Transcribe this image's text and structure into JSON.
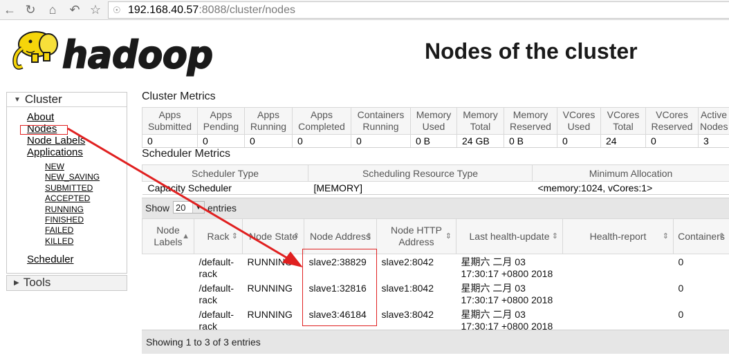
{
  "browser": {
    "url_host": "192.168.40.57",
    "url_rest": ":8088/cluster/nodes",
    "icons": [
      "back-icon",
      "reload-icon",
      "home-icon",
      "undo-icon",
      "star-icon",
      "shield-icon"
    ]
  },
  "header": {
    "logo_text": "hadoop",
    "title": "Nodes of the cluster"
  },
  "sidebar": {
    "cluster_label": "Cluster",
    "links": [
      "About",
      "Nodes",
      "Node Labels",
      "Applications"
    ],
    "app_states": [
      "NEW",
      "NEW_SAVING",
      "SUBMITTED",
      "ACCEPTED",
      "RUNNING",
      "FINISHED",
      "FAILED",
      "KILLED"
    ],
    "scheduler": "Scheduler",
    "tools_label": "Tools"
  },
  "cluster_metrics": {
    "title": "Cluster Metrics",
    "headers": [
      "Apps Submitted",
      "Apps Pending",
      "Apps Running",
      "Apps Completed",
      "Containers Running",
      "Memory Used",
      "Memory Total",
      "Memory Reserved",
      "VCores Used",
      "VCores Total",
      "VCores Reserved",
      "Active Nodes"
    ],
    "values": [
      "0",
      "0",
      "0",
      "0",
      "0",
      "0 B",
      "24 GB",
      "0 B",
      "0",
      "24",
      "0",
      "3"
    ]
  },
  "scheduler_metrics": {
    "title": "Scheduler Metrics",
    "headers": [
      "Scheduler Type",
      "Scheduling Resource Type",
      "Minimum Allocation"
    ],
    "values": [
      "Capacity Scheduler",
      "[MEMORY]",
      "<memory:1024, vCores:1>"
    ]
  },
  "nodes_table": {
    "show": "Show",
    "page_size": "20",
    "entries": "entries",
    "headers": [
      "Node Labels",
      "Rack",
      "Node State",
      "Node Address",
      "Node HTTP Address",
      "Last health-update",
      "Health-report",
      "Containers"
    ],
    "rows": [
      {
        "rack": "/default-rack",
        "state": "RUNNING",
        "address": "slave2:38829",
        "http": "slave2:8042",
        "update_1": "星期六 二月 03",
        "update_2": "17:30:17 +0800 2018",
        "containers": "0"
      },
      {
        "rack": "/default-rack",
        "state": "RUNNING",
        "address": "slave1:32816",
        "http": "slave1:8042",
        "update_1": "星期六 二月 03",
        "update_2": "17:30:17 +0800 2018",
        "containers": "0"
      },
      {
        "rack": "/default-rack",
        "state": "RUNNING",
        "address": "slave3:46184",
        "http": "slave3:8042",
        "update_1": "星期六 二月 03",
        "update_2": "17:30:17 +0800 2018",
        "containers": "0"
      }
    ],
    "info": "Showing 1 to 3 of 3 entries"
  },
  "annotation_color": "#e02020"
}
